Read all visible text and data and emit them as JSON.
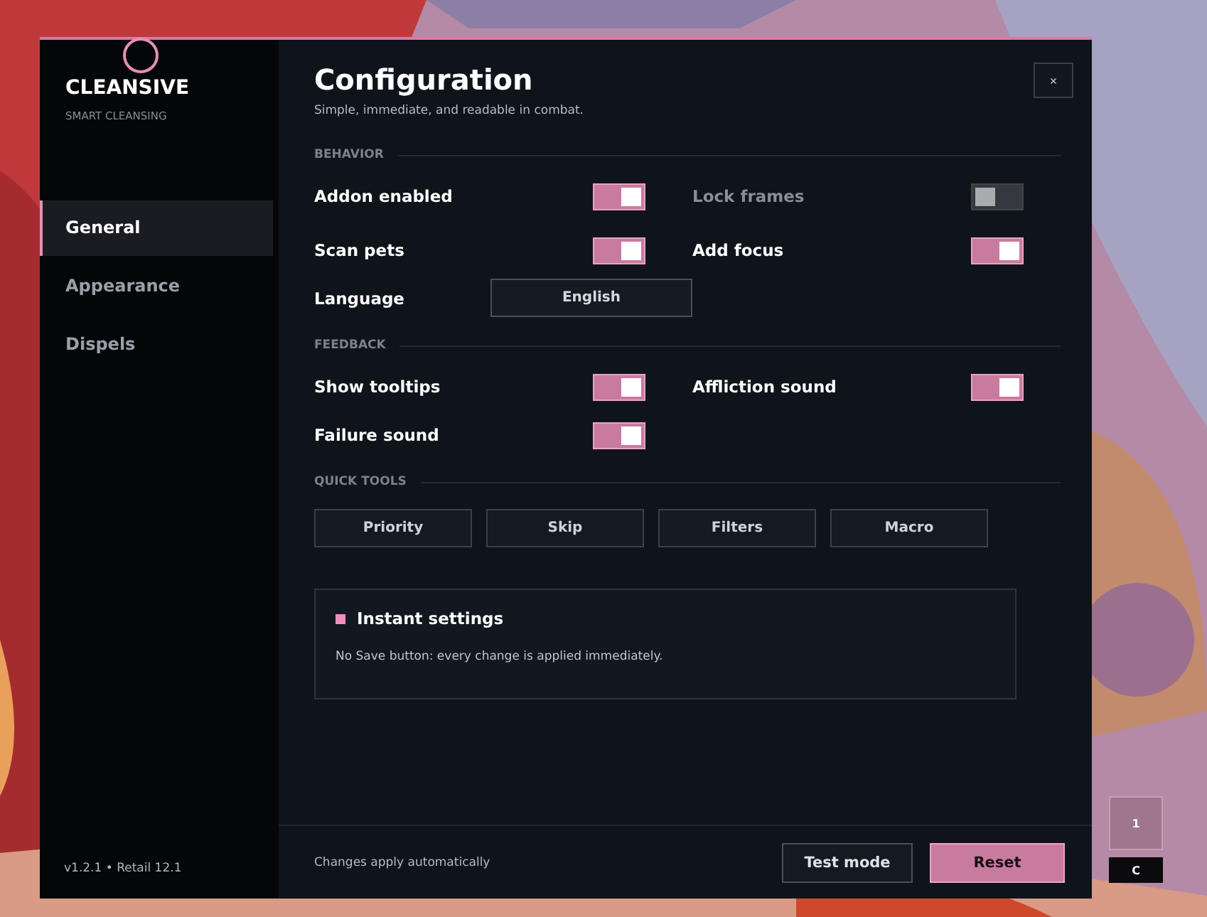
{
  "sidebar": {
    "logo": "CLEANSIVE",
    "tagline": "SMART CLEANSING",
    "items": [
      {
        "label": "General",
        "selected": true
      },
      {
        "label": "Appearance",
        "selected": false
      },
      {
        "label": "Dispels",
        "selected": false
      }
    ],
    "version": "v1.2.1  •  Retail 12.1"
  },
  "header": {
    "title": "Configuration",
    "subtitle": "Simple, immediate, and readable in combat.",
    "close": "×"
  },
  "sections": [
    {
      "heading": "BEHAVIOR",
      "rows": [
        [
          {
            "kind": "toggle",
            "label": "Addon enabled",
            "on": true
          },
          {
            "kind": "toggle",
            "label": "Lock frames",
            "on": false
          }
        ],
        [
          {
            "kind": "toggle",
            "label": "Scan pets",
            "on": true
          },
          {
            "kind": "toggle",
            "label": "Add focus",
            "on": true
          }
        ],
        [
          {
            "kind": "select",
            "label": "Language",
            "value": "English"
          }
        ]
      ]
    },
    {
      "heading": "FEEDBACK",
      "rows": [
        [
          {
            "kind": "toggle",
            "label": "Show tooltips",
            "on": true
          },
          {
            "kind": "toggle",
            "label": "Affliction sound",
            "on": true
          }
        ],
        [
          {
            "kind": "toggle",
            "label": "Failure sound",
            "on": true
          }
        ]
      ]
    },
    {
      "heading": "QUICK TOOLS",
      "buttons": [
        "Priority",
        "Skip",
        "Filters",
        "Macro"
      ]
    }
  ],
  "info": {
    "title": "Instant settings",
    "text": "No Save button: every change is applied immediately."
  },
  "footer": {
    "note": "Changes apply automatically",
    "buttons": [
      {
        "label": "Test mode",
        "kind": "secondary"
      },
      {
        "label": "Reset",
        "kind": "primary"
      }
    ]
  },
  "side_widget": {
    "count": "1",
    "key": "C"
  }
}
